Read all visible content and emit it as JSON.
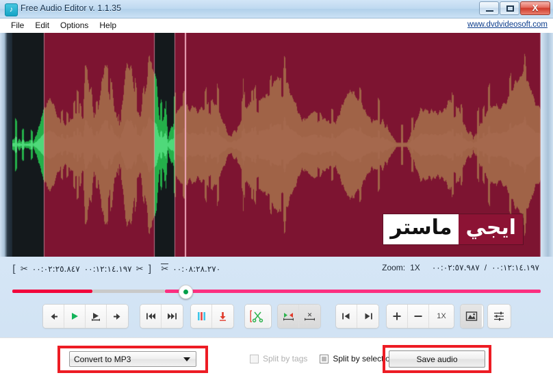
{
  "window": {
    "title": "Free Audio Editor v. 1.1.35",
    "icon": "music-note-icon",
    "minimize_label": "Minimize",
    "maximize_label": "Maximize",
    "close_label": "X"
  },
  "menu": {
    "items": [
      {
        "label": "File"
      },
      {
        "label": "Edit"
      },
      {
        "label": "Options"
      },
      {
        "label": "Help"
      }
    ],
    "brand_link": "www.dvdvideosoft.com"
  },
  "waveform": {
    "watermark_right": "ايجي",
    "watermark_left": "ماستر",
    "background_color": "#14191c",
    "wave_color": "#24b04a",
    "selection_color": "#8c1334",
    "cursor_color": "#f0a8bb"
  },
  "timebar": {
    "selection_start": "٠٠:٠٢:٢٥.٨٤٧",
    "selection_end": "٠٠:١٢:١٤.١٩٧",
    "cursor_time": "٠٠:٠٨:٢٨.٢٧٠",
    "zoom_label": "Zoom:",
    "zoom_value": "1X",
    "position_time": "٠٠:٠٢:٥٧.٩٨٧",
    "separator": "/",
    "total_time": "٠٠:١٢:١٤.١٩٧"
  },
  "transport": {
    "groups": [
      {
        "name": "playback",
        "buttons": [
          {
            "name": "step-back-button",
            "icon": "arrow-left-icon"
          },
          {
            "name": "play-button",
            "icon": "play-icon"
          },
          {
            "name": "play-selection-button",
            "icon": "play-selection-icon"
          },
          {
            "name": "step-forward-button",
            "icon": "arrow-right-icon"
          }
        ]
      },
      {
        "name": "skip",
        "buttons": [
          {
            "name": "skip-to-start-button",
            "icon": "skip-back-icon"
          },
          {
            "name": "skip-to-end-button",
            "icon": "skip-forward-icon"
          }
        ]
      },
      {
        "name": "pause-record",
        "buttons": [
          {
            "name": "pause-button",
            "icon": "pause-icon"
          },
          {
            "name": "record-button",
            "icon": "record-down-arrow-icon"
          }
        ]
      },
      {
        "name": "cut",
        "buttons": [
          {
            "name": "cut-selection-button",
            "icon": "scissors-icon"
          }
        ]
      },
      {
        "name": "selection-tools",
        "buttons": [
          {
            "name": "select-region-button",
            "icon": "select-region-icon"
          },
          {
            "name": "delete-region-button",
            "icon": "delete-region-icon"
          }
        ]
      },
      {
        "name": "marker-nav",
        "buttons": [
          {
            "name": "previous-marker-button",
            "icon": "marker-left-icon"
          },
          {
            "name": "next-marker-button",
            "icon": "marker-right-icon"
          }
        ]
      },
      {
        "name": "zoom-controls",
        "buttons": [
          {
            "name": "zoom-in-button",
            "icon": "plus-icon"
          },
          {
            "name": "zoom-out-button",
            "icon": "minus-icon"
          },
          {
            "name": "zoom-level-button",
            "icon": "zoom-level-text",
            "label": "1X"
          }
        ]
      },
      {
        "name": "view",
        "buttons": [
          {
            "name": "spectrum-view-button",
            "icon": "image-icon"
          }
        ]
      },
      {
        "name": "settings",
        "buttons": [
          {
            "name": "effects-settings-button",
            "icon": "sliders-icon"
          }
        ]
      }
    ]
  },
  "bottom": {
    "format_select_value": "Convert to MP3",
    "split_by_tags_label": "Split by tags",
    "split_by_tags_checked": false,
    "split_by_tags_enabled": false,
    "split_by_selections_label": "Split by selections",
    "split_by_selections_checked": false,
    "save_button_label": "Save audio",
    "highlight_color": "#ed1c24"
  },
  "slider": {
    "played_color": "#f2063c",
    "track_color": "#c9c9c9",
    "remaining_color": "#fc2f80",
    "knob_color": "#00a04a",
    "knob_position_percent": 32
  }
}
